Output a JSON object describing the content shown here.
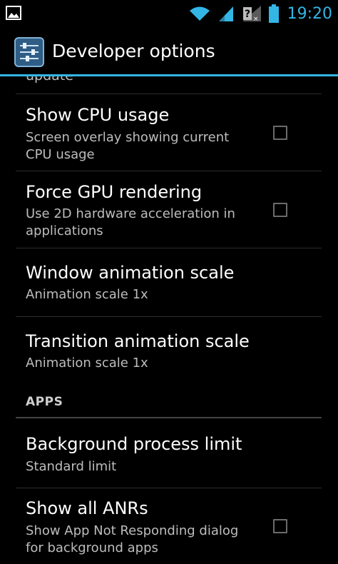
{
  "status_bar": {
    "time": "19:20",
    "icons": [
      "picture-icon",
      "wifi-icon",
      "signal-icon",
      "no-sim-icon",
      "battery-icon"
    ]
  },
  "action_bar": {
    "title": "Developer options",
    "icon": "settings-sliders-icon"
  },
  "list": {
    "cut_off_summary": "update",
    "items": [
      {
        "title": "Show CPU usage",
        "summary": "Screen overlay showing current CPU usage",
        "checkbox": true,
        "checked": false
      },
      {
        "title": "Force GPU rendering",
        "summary": "Use 2D hardware acceleration in applications",
        "checkbox": true,
        "checked": false
      },
      {
        "title": "Window animation scale",
        "summary": "Animation scale 1x",
        "checkbox": false
      },
      {
        "title": "Transition animation scale",
        "summary": "Animation scale 1x",
        "checkbox": false
      }
    ],
    "section_header": "APPS",
    "apps_items": [
      {
        "title": "Background process limit",
        "summary": "Standard limit",
        "checkbox": false
      },
      {
        "title": "Show all ANRs",
        "summary": "Show App Not Responding dialog for background apps",
        "checkbox": true,
        "checked": false
      }
    ]
  },
  "colors": {
    "accent": "#33b5e5",
    "background": "#000000",
    "summary_text": "#bdbdbd"
  }
}
